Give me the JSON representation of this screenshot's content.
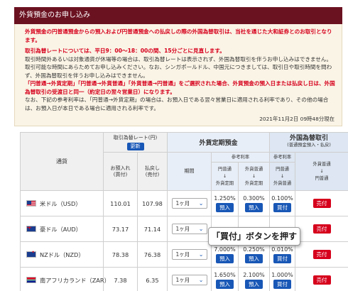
{
  "header": {
    "title": "外貨預金のお申し込み"
  },
  "notice": {
    "p1": "外貨預金の円普通預金からの預入および円普通預金への払戻しの際の外国為替取引は、当社を通じた大和証券とのお取引となります。",
    "p2": "取引為替レートについては、平日9：00〜18：00の間、15分ごとに見直します。",
    "p3": "取引時間外あるいは対象通貨が休場等の場合は、取引為替レートは表示されず、外国為替取引を伴うお申し込みはできません。取引可能な時間にあらためてお申し込みください。なお、シンガポールドル、中国元につきましては、取引日や取引時間を問わず、外国為替取引を伴うお申し込みはできません。",
    "p4": "「円普通→外貨定期」「円普通→外貨普通」「外貨普通→円普通」をご選択された場合、外貨預金の預入日または払戻し日は、外国為替取引の受渡日と同一（約定日の翌々営業日）になります。",
    "p5": "なお、下記の参考利率は、「円普通→外貨定期」の場合は、お預入日である翌々営業日に適用される利率であり、その他の場合は、お預入日が本日である場合に適用される利率です。",
    "timestamp": "2021年11月2日 09時48分現在"
  },
  "table": {
    "col_currency": "通貨",
    "col_rate": "取引為替レート(円)",
    "update_button": "更新",
    "col_deposit": "お預入れ",
    "col_deposit_sub": "(買付)",
    "col_withdraw": "払戻し",
    "col_withdraw_sub": "(売付)",
    "col_fixed": "外貨定期預金",
    "col_term": "期間",
    "col_ref_rate": "参考利率",
    "col_yen_to_fixed_1": "円普通",
    "col_yen_to_fixed_2": "↓",
    "col_yen_to_fixed_3": "外貨定期",
    "col_fx_to_fixed_1": "外貨普通",
    "col_fx_to_fixed_2": "↓",
    "col_fx_to_fixed_3": "外貨定期",
    "col_fx": "外国為替取引",
    "col_fx_sub": "(普通預金預入・払戻)",
    "col_yen_to_fx_1": "円普通",
    "col_yen_to_fx_2": "↓",
    "col_yen_to_fx_3": "外貨普通",
    "col_fx_to_yen_1": "外貨普通",
    "col_fx_to_yen_2": "↓",
    "col_fx_to_yen_3": "円普通",
    "rows": [
      {
        "name": "米ドル（USD）",
        "buy": "110.01",
        "sell": "107.98",
        "term": "1ヶ月",
        "rate1": "1.250%",
        "btn1": "預入",
        "rate2": "0.300%",
        "btn2": "預入",
        "rate3": "0.100%",
        "btn3": "買付",
        "btn4": "売付",
        "flag": "us-flag-icon"
      },
      {
        "name": "豪ドル（AUD）",
        "buy": "73.17",
        "sell": "71.14",
        "term": "1ヶ月",
        "rate1": "",
        "btn1": "",
        "rate2": "",
        "btn2": "",
        "rate3": "",
        "btn3": "",
        "btn4": "売付",
        "flag": "au-flag-icon"
      },
      {
        "name": "NZドル（NZD）",
        "buy": "78.38",
        "sell": "76.38",
        "term": "1ヶ月",
        "rate1": "7.000%",
        "btn1": "預入",
        "rate2": "0.250%",
        "btn2": "預入",
        "rate3": "0.010%",
        "btn3": "買付",
        "btn4": "売付",
        "flag": "nz-flag-icon"
      },
      {
        "name": "南アフリカランド（ZAR）",
        "buy": "7.38",
        "sell": "6.35",
        "term": "1ヶ月",
        "rate1": "1.650%",
        "btn1": "預入",
        "rate2": "2.100%",
        "btn2": "預入",
        "rate3": "1.000%",
        "btn3": "買付",
        "btn4": "売付",
        "flag": "za-flag-icon"
      }
    ]
  },
  "tooltip": {
    "text": "「買付」ボタンを押す"
  }
}
